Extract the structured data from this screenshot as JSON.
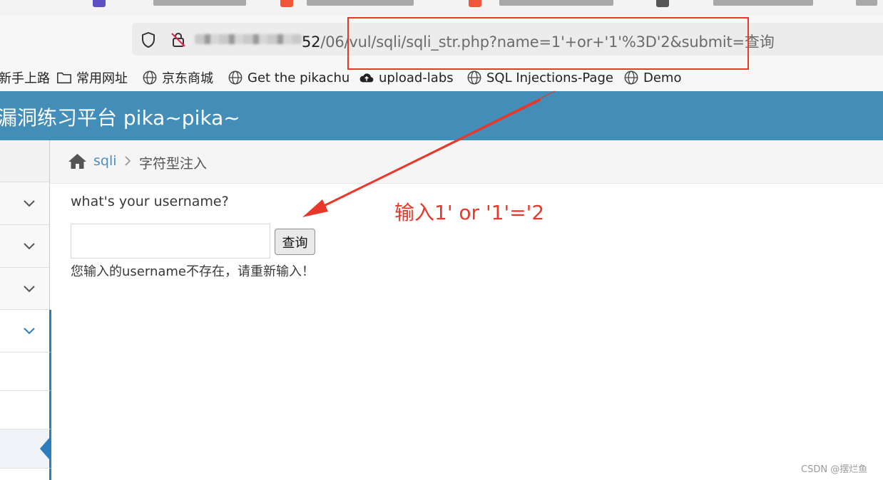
{
  "browser": {
    "url": {
      "visible_dark": "52",
      "visible_rest": "/06/vul/sqli/sqli_str.php?name=1'+or+'1'%3D'2&submit=查询"
    },
    "bookmarks": [
      {
        "label": "新手上路",
        "icon": "none"
      },
      {
        "label": "常用网址",
        "icon": "folder-icon"
      },
      {
        "label": "京东商城",
        "icon": "globe-icon"
      },
      {
        "label": "Get the pikachu",
        "icon": "globe-icon"
      },
      {
        "label": "upload-labs",
        "icon": "cloud-icon"
      },
      {
        "label": "SQL Injections-Page",
        "icon": "globe-icon"
      },
      {
        "label": "Demo",
        "icon": "globe-icon"
      }
    ]
  },
  "header": {
    "title": "漏洞练习平台 pika~pika~",
    "background": "#438eb9"
  },
  "breadcrumb": {
    "parent": "sqli",
    "current": "字符型注入"
  },
  "form": {
    "question": "what's your username?",
    "input_value": "",
    "submit_label": "查询",
    "result_message": "您输入的username不存在，请重新输入！"
  },
  "annotation": {
    "text": "输入1' or '1'='2",
    "color": "#e8382b"
  },
  "watermark": "CSDN @摆烂鱼"
}
